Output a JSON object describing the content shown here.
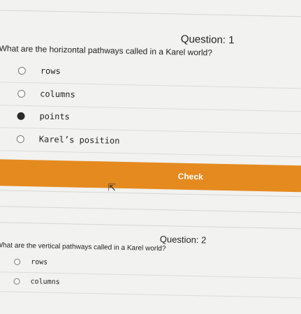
{
  "question1": {
    "title": "Question: 1",
    "text": "What are the horizontal pathways called in a Karel world?",
    "options": [
      {
        "label": "rows",
        "selected": false
      },
      {
        "label": "columns",
        "selected": false
      },
      {
        "label": "points",
        "selected": true
      },
      {
        "label": "Karel’s position",
        "selected": false
      }
    ],
    "check_label": "Check"
  },
  "question2": {
    "title": "Question: 2",
    "text": "What are the vertical pathways called in a Karel world?",
    "options": [
      {
        "label": "rows",
        "selected": false
      },
      {
        "label": "columns",
        "selected": false
      }
    ]
  },
  "icons": {
    "cursor": "mouse-pointer-icon"
  },
  "colors": {
    "check_button": "#e58a1f",
    "background": "#f2f2f0"
  }
}
